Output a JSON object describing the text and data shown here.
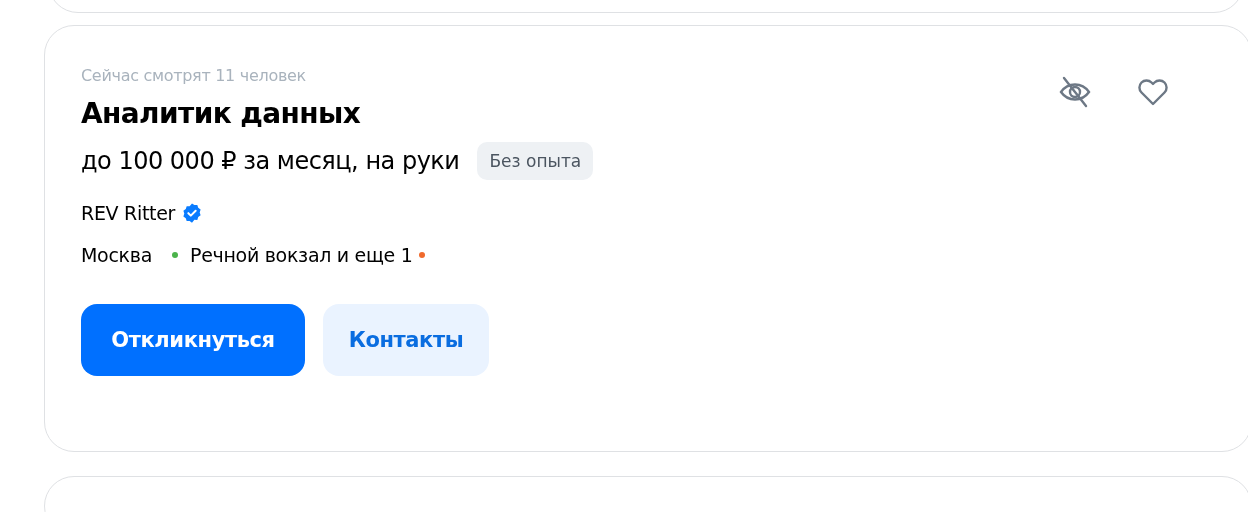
{
  "card": {
    "viewers": "Сейчас смотрят 11 человек",
    "title": "Аналитик данных",
    "salary": "до 100 000 ₽ за месяц, на руки",
    "experience_tag": "Без опыта",
    "company": {
      "name": "REV Ritter",
      "verified": true
    },
    "location": {
      "city": "Москва",
      "metro": "Речной вокзал и еще 1",
      "line_colors": [
        {
          "color": "#4bb34b"
        },
        {
          "color": "#f06a2c"
        }
      ]
    },
    "buttons": [
      {
        "label": "Откликнуться",
        "kind": "primary"
      },
      {
        "label": "Контакты",
        "kind": "secondary"
      }
    ]
  }
}
